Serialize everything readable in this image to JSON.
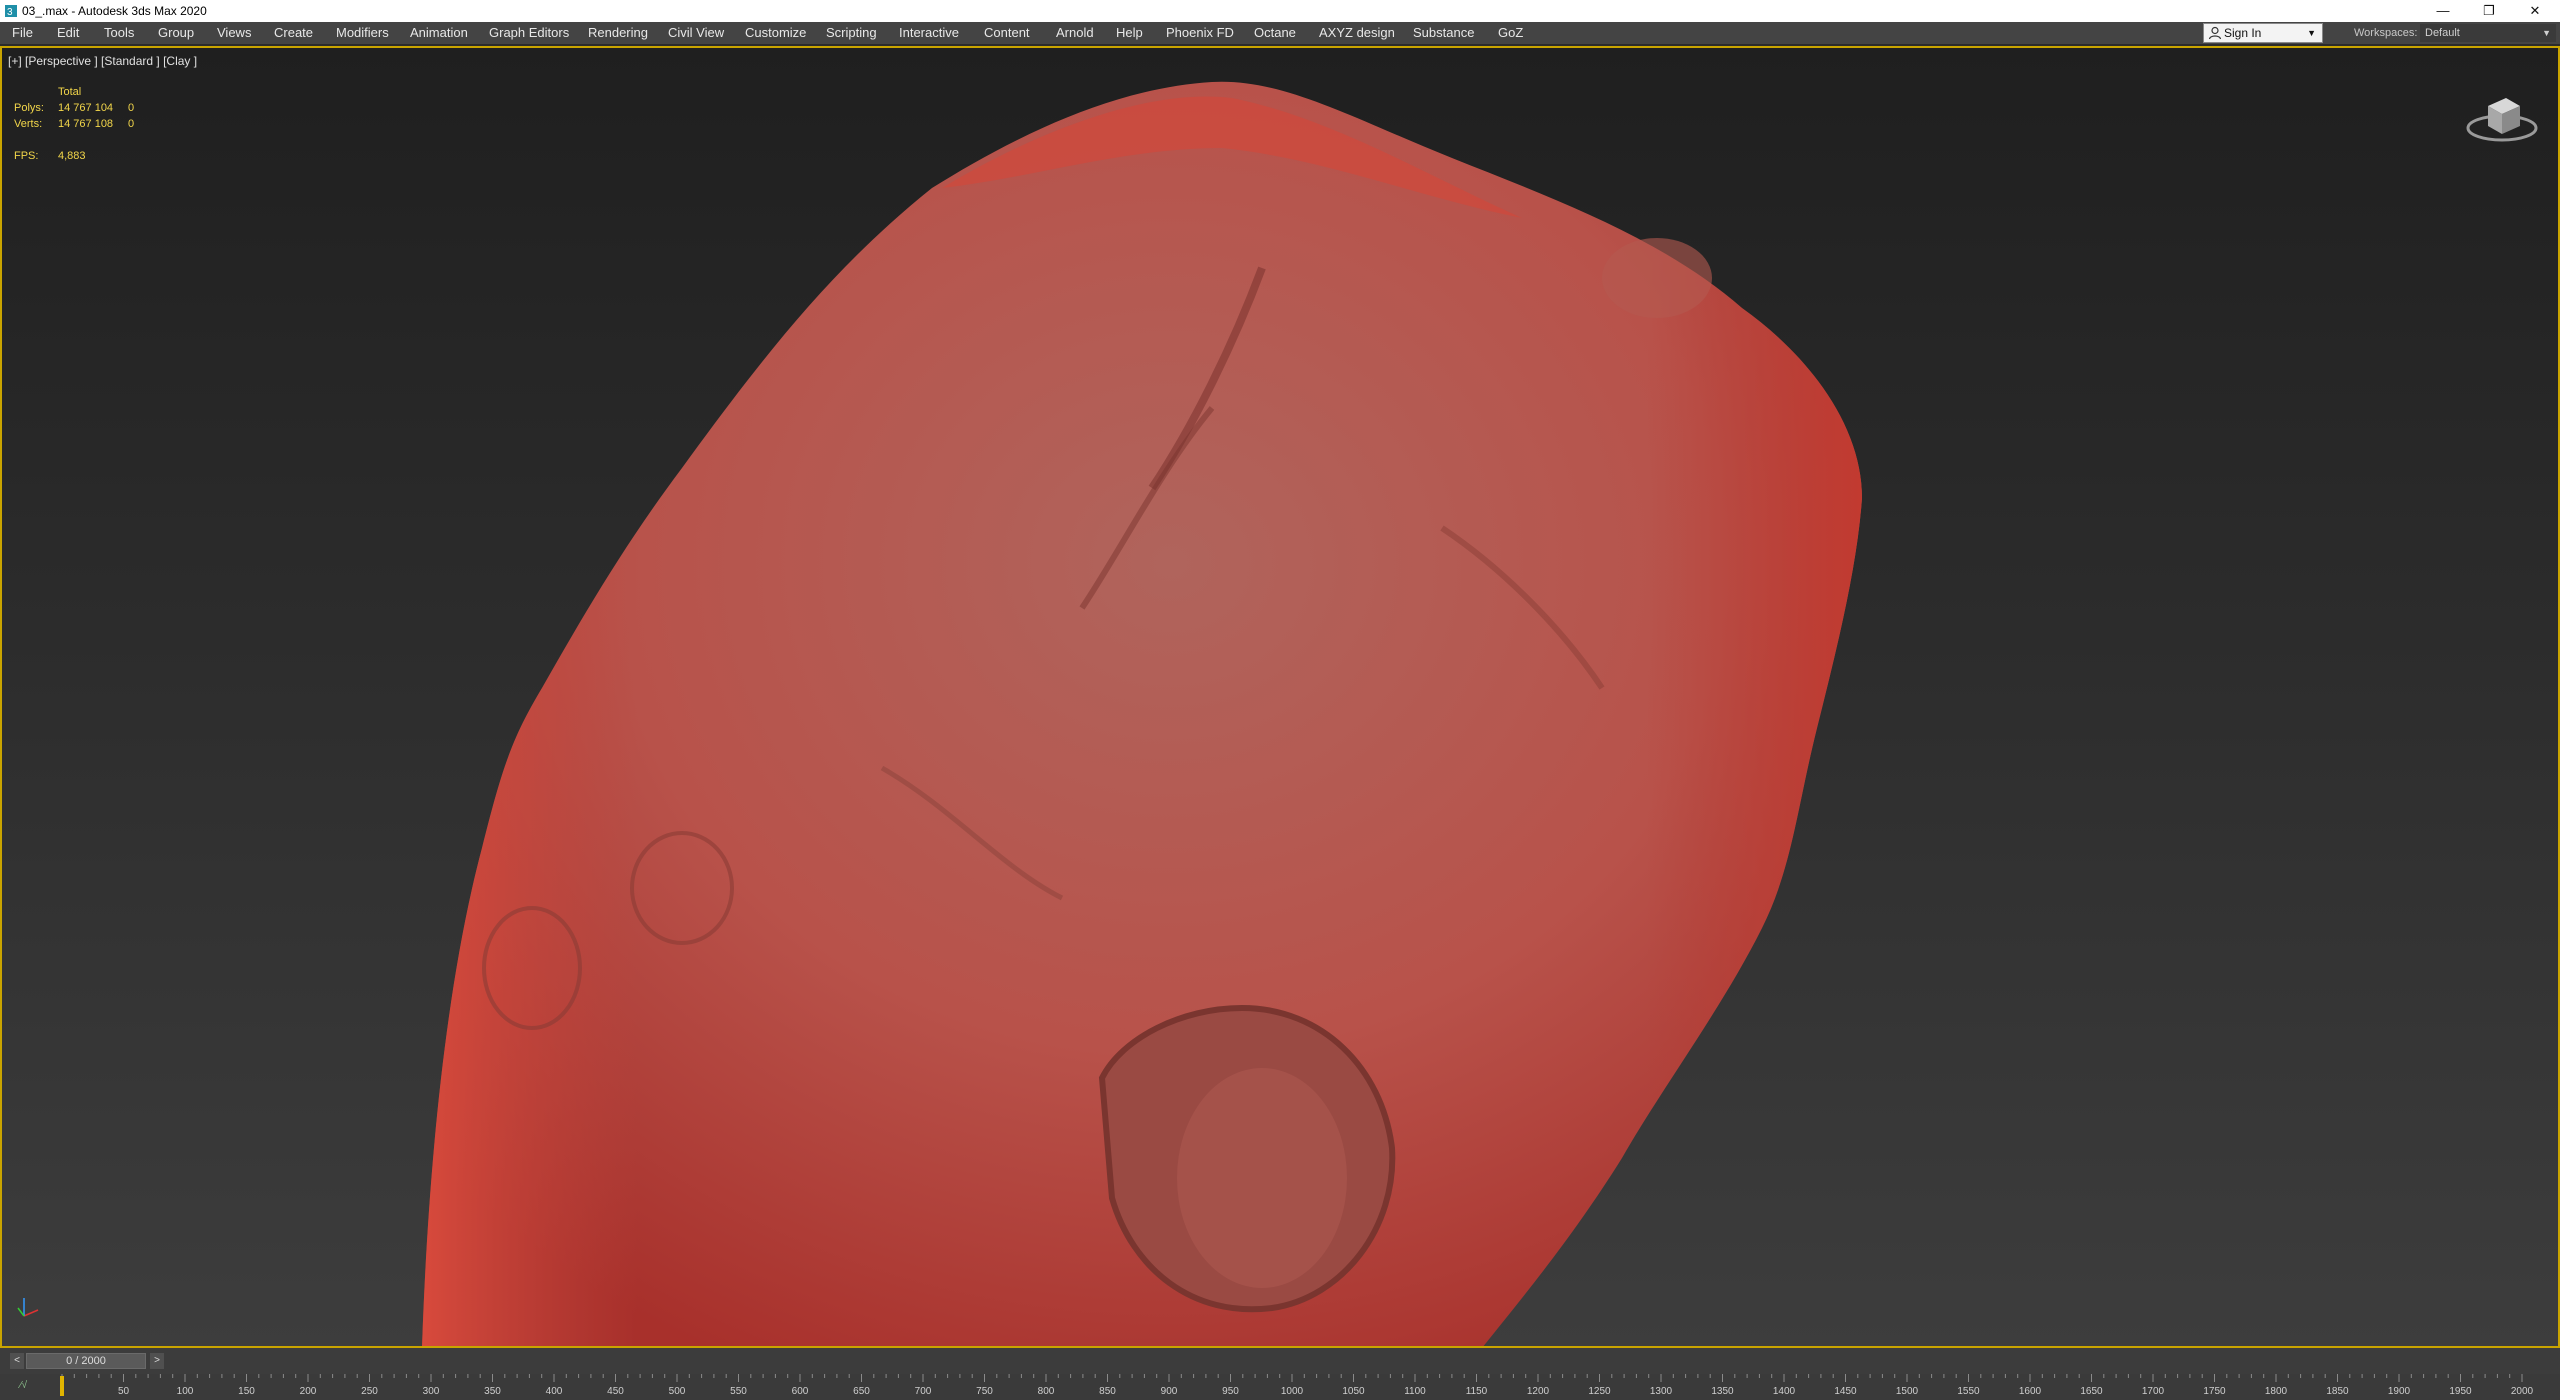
{
  "window": {
    "title": "03_.max - Autodesk 3ds Max 2020",
    "minimize": "—",
    "restore": "❐",
    "close": "✕"
  },
  "menu": {
    "items": [
      "File",
      "Edit",
      "Tools",
      "Group",
      "Views",
      "Create",
      "Modifiers",
      "Animation",
      "Graph Editors",
      "Rendering",
      "Civil View",
      "Customize",
      "Scripting",
      "Interactive",
      "Content",
      "Arnold",
      "Help",
      "Phoenix FD",
      "Octane",
      "AXYZ design",
      "Substance",
      "GoZ"
    ],
    "sign_in": "Sign In",
    "workspaces_label": "Workspaces:",
    "workspace_value": "Default"
  },
  "viewport": {
    "label": "[+] [Perspective ] [Standard ] [Clay ]",
    "stats": {
      "header": "Total",
      "polys_label": "Polys:",
      "polys_value": "14 767 104",
      "polys_sel": "0",
      "verts_label": "Verts:",
      "verts_value": "14 767 108",
      "verts_sel": "0",
      "fps_label": "FPS:",
      "fps_value": "4,883"
    }
  },
  "timeslider": {
    "prev": "<",
    "next": ">",
    "frame": "0 / 2000"
  },
  "trackbar": {
    "ticks": [
      "50",
      "100",
      "150",
      "200",
      "250",
      "300",
      "350",
      "400",
      "450",
      "500",
      "550",
      "600",
      "650",
      "700",
      "750",
      "800",
      "850",
      "900",
      "950",
      "1000",
      "1050",
      "1100",
      "1150",
      "1200",
      "1250",
      "1300",
      "1350",
      "1400",
      "1450",
      "1500",
      "1550",
      "1600",
      "1650",
      "1700",
      "1750",
      "1800",
      "1850",
      "1900",
      "1950",
      "2000"
    ]
  },
  "colors": {
    "accent_border": "#c9a400",
    "stats_text": "#f2d64a",
    "rock": "#b9544c",
    "menubar": "#444444"
  }
}
